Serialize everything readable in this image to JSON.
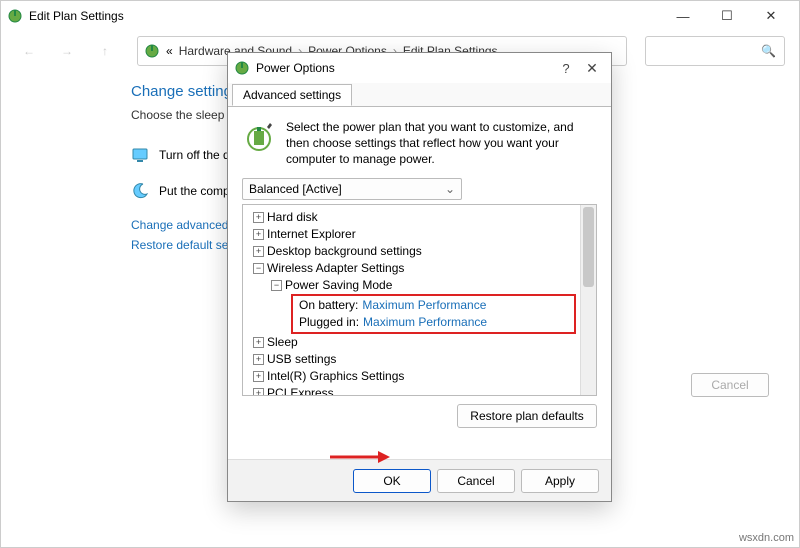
{
  "parent": {
    "title": "Edit Plan Settings",
    "breadcrumb": [
      "Hardware and Sound",
      "Power Options",
      "Edit Plan Settings"
    ],
    "heading": "Change settings for the plan:",
    "subhead": "Choose the sleep and display settings that you want your computer to use.",
    "row1": "Turn off the display:",
    "row2": "Put the computer to sleep:",
    "link1": "Change advanced power settings",
    "link2": "Restore default settings for this plan",
    "btn_cancel": "Cancel"
  },
  "dialog": {
    "title": "Power Options",
    "tab": "Advanced settings",
    "message": "Select the power plan that you want to customize, and then choose settings that reflect how you want your computer to manage power.",
    "plan": "Balanced [Active]",
    "tree": {
      "n0": "Hard disk",
      "n1": "Internet Explorer",
      "n2": "Desktop background settings",
      "n3": "Wireless Adapter Settings",
      "n3a": "Power Saving Mode",
      "leaf1_label": "On battery:",
      "leaf1_val": "Maximum Performance",
      "leaf2_label": "Plugged in:",
      "leaf2_val": "Maximum Performance",
      "n4": "Sleep",
      "n5": "USB settings",
      "n6": "Intel(R) Graphics Settings",
      "n7": "PCI Express"
    },
    "btn_restore": "Restore plan defaults",
    "btn_ok": "OK",
    "btn_cancel": "Cancel",
    "btn_apply": "Apply"
  },
  "watermark": "wsxdn.com"
}
